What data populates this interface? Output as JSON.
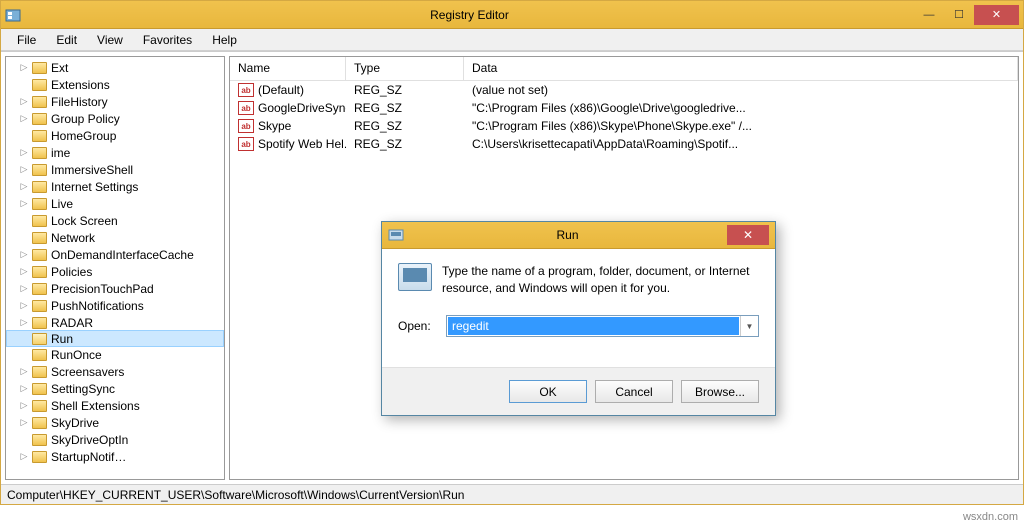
{
  "window": {
    "title": "Registry Editor"
  },
  "menubar": [
    "File",
    "Edit",
    "View",
    "Favorites",
    "Help"
  ],
  "tree": {
    "items": [
      {
        "label": "Ext",
        "expandable": true
      },
      {
        "label": "Extensions",
        "expandable": false
      },
      {
        "label": "FileHistory",
        "expandable": true
      },
      {
        "label": "Group Policy",
        "expandable": true
      },
      {
        "label": "HomeGroup",
        "expandable": false
      },
      {
        "label": "ime",
        "expandable": true
      },
      {
        "label": "ImmersiveShell",
        "expandable": true
      },
      {
        "label": "Internet Settings",
        "expandable": true
      },
      {
        "label": "Live",
        "expandable": true
      },
      {
        "label": "Lock Screen",
        "expandable": false
      },
      {
        "label": "Network",
        "expandable": false
      },
      {
        "label": "OnDemandInterfaceCache",
        "expandable": true
      },
      {
        "label": "Policies",
        "expandable": true
      },
      {
        "label": "PrecisionTouchPad",
        "expandable": true
      },
      {
        "label": "PushNotifications",
        "expandable": true
      },
      {
        "label": "RADAR",
        "expandable": true
      },
      {
        "label": "Run",
        "expandable": false,
        "selected": true
      },
      {
        "label": "RunOnce",
        "expandable": false
      },
      {
        "label": "Screensavers",
        "expandable": true
      },
      {
        "label": "SettingSync",
        "expandable": true
      },
      {
        "label": "Shell Extensions",
        "expandable": true
      },
      {
        "label": "SkyDrive",
        "expandable": true
      },
      {
        "label": "SkyDriveOptIn",
        "expandable": false
      },
      {
        "label": "StartupNotif…",
        "expandable": true
      }
    ]
  },
  "list": {
    "columns": [
      "Name",
      "Type",
      "Data"
    ],
    "rows": [
      {
        "name": "(Default)",
        "type": "REG_SZ",
        "data": "(value not set)"
      },
      {
        "name": "GoogleDriveSync",
        "type": "REG_SZ",
        "data": "\"C:\\Program Files (x86)\\Google\\Drive\\googledrive..."
      },
      {
        "name": "Skype",
        "type": "REG_SZ",
        "data": "\"C:\\Program Files (x86)\\Skype\\Phone\\Skype.exe\" /..."
      },
      {
        "name": "Spotify Web Hel...",
        "type": "REG_SZ",
        "data": "C:\\Users\\krisettecapati\\AppData\\Roaming\\Spotif..."
      }
    ]
  },
  "statusbar": "Computer\\HKEY_CURRENT_USER\\Software\\Microsoft\\Windows\\CurrentVersion\\Run",
  "run_dialog": {
    "title": "Run",
    "description": "Type the name of a program, folder, document, or Internet resource, and Windows will open it for you.",
    "open_label": "Open:",
    "open_value": "regedit",
    "buttons": {
      "ok": "OK",
      "cancel": "Cancel",
      "browse": "Browse..."
    }
  },
  "attribution": "wsxdn.com"
}
